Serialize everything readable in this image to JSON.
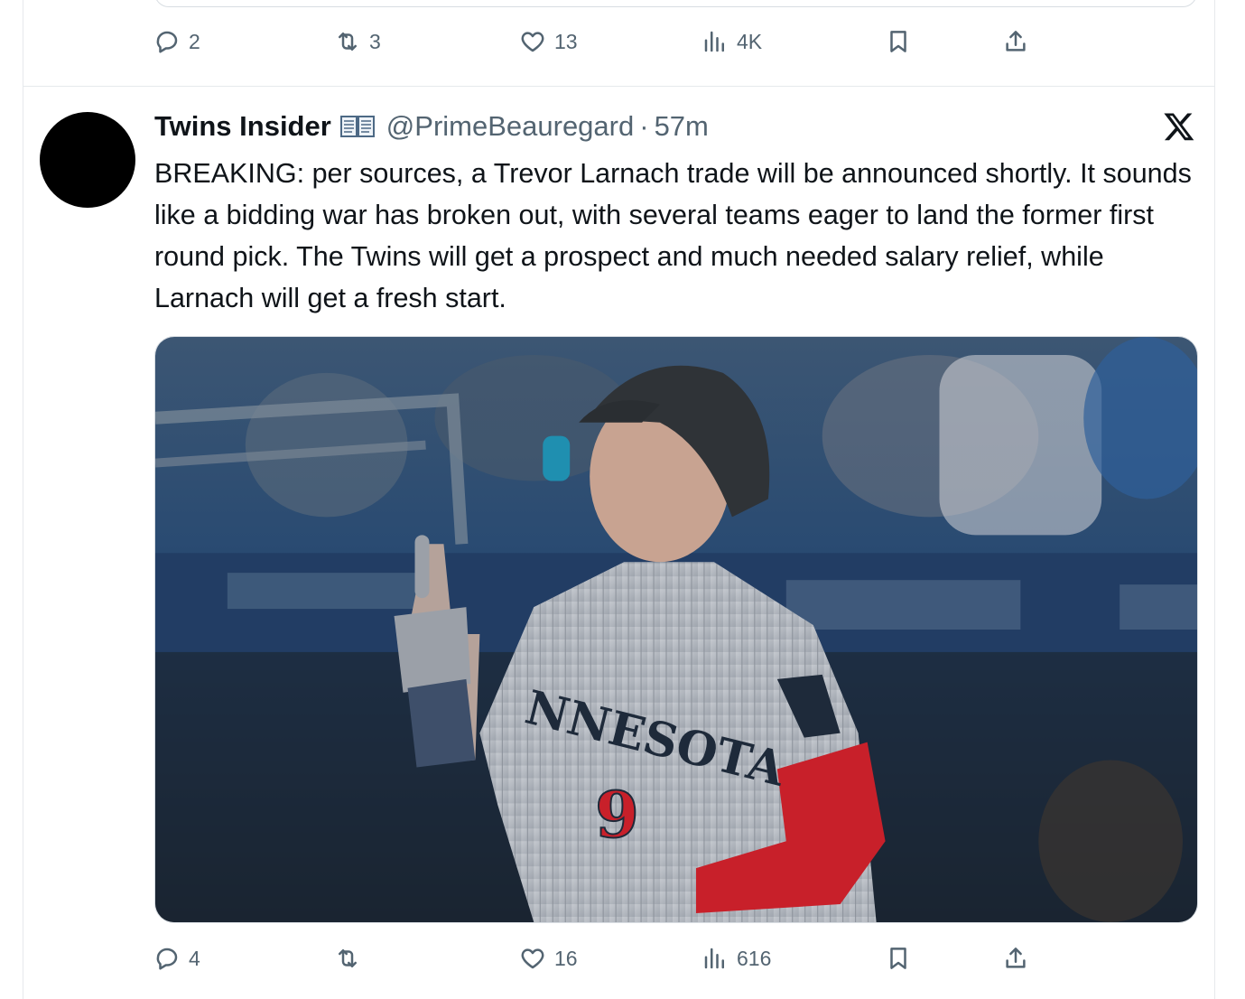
{
  "previous_tweet": {
    "actions": {
      "replies": "2",
      "reposts": "3",
      "likes": "13",
      "views": "4K"
    }
  },
  "tweet": {
    "display_name": "Twins Insider",
    "name_emoji_icon": "open-book-icon",
    "handle": "@PrimeBeauregard",
    "separator": "·",
    "time": "57m",
    "text": "BREAKING: per sources, a Trevor Larnach trade will be announced shortly. It sounds like a bidding war has broken out, with several teams eager to land the former first round pick. The Twins will get a prospect and much needed salary relief, while Larnach will get a fresh start.",
    "media": {
      "jersey_text": "NNESOTA",
      "jersey_number": "9"
    },
    "actions": {
      "replies": "4",
      "reposts": "",
      "likes": "16",
      "views": "616"
    }
  },
  "colors": {
    "text": "#0f1419",
    "secondary": "#536471",
    "border": "#e6e9ec",
    "jersey_red": "#c8202a"
  }
}
